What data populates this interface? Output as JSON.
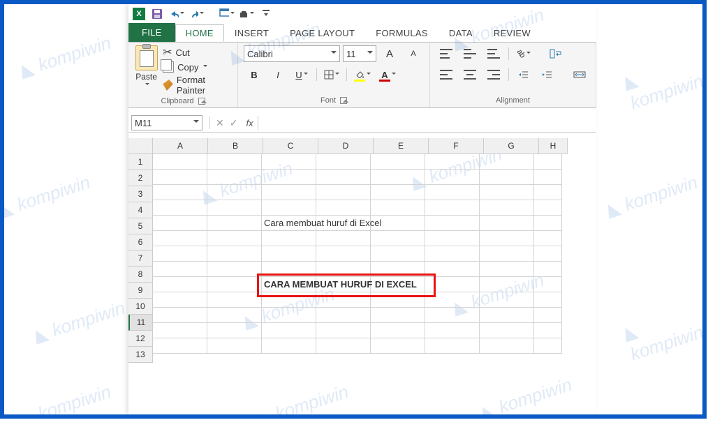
{
  "qat": {
    "app": "X"
  },
  "tabs": {
    "file": "FILE",
    "home": "HOME",
    "insert": "INSERT",
    "pagelayout": "PAGE LAYOUT",
    "formulas": "FORMULAS",
    "data": "DATA",
    "review": "REVIEW"
  },
  "clipboard": {
    "paste": "Paste",
    "cut": "Cut",
    "copy": "Copy",
    "fmt": "Format Painter",
    "label": "Clipboard"
  },
  "font": {
    "name": "Calibri",
    "size": "11",
    "b": "B",
    "i": "I",
    "u": "U",
    "label": "Font",
    "a_big": "A",
    "a_small": "A"
  },
  "alignment": {
    "label": "Alignment"
  },
  "namebox": "M11",
  "fx": "fx",
  "columns": [
    "A",
    "B",
    "C",
    "D",
    "E",
    "F",
    "G",
    "H"
  ],
  "rows": [
    "1",
    "2",
    "3",
    "4",
    "5",
    "6",
    "7",
    "8",
    "9",
    "10",
    "11",
    "12",
    "13"
  ],
  "cell_c5": "Cara membuat huruf di Excel",
  "cell_c9": "CARA MEMBUAT HURUF DI EXCEL",
  "watermark": "kompiwin"
}
